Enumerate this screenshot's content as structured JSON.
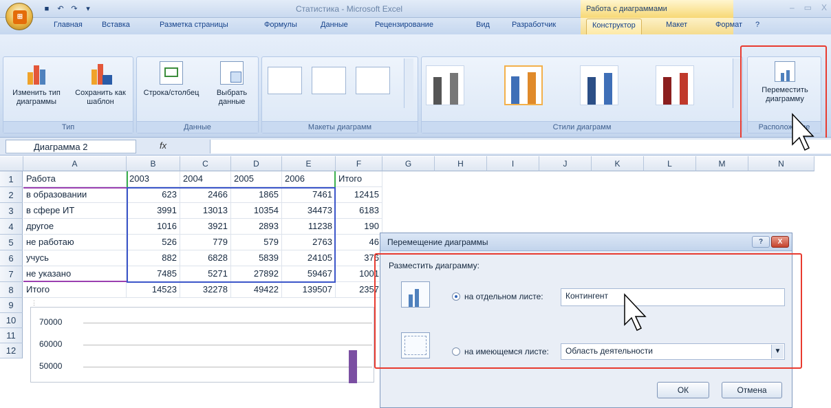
{
  "window": {
    "title": "Статистика - Microsoft Excel",
    "context_group": "Работа с диаграммами",
    "controls": [
      "–",
      "▭",
      "X"
    ]
  },
  "tabs": [
    "Главная",
    "Вставка",
    "Разметка страницы",
    "Формулы",
    "Данные",
    "Рецензирование",
    "Вид",
    "Разработчик",
    "Конструктор",
    "Макет",
    "Формат"
  ],
  "active_tab": "Конструктор",
  "ribbon": {
    "groups": {
      "type": {
        "label": "Тип",
        "change_type": "Изменить тип диаграммы",
        "save_template": "Сохранить как шаблон"
      },
      "data": {
        "label": "Данные",
        "switch_row_col": "Строка/столбец",
        "select_data": "Выбрать данные"
      },
      "layouts": {
        "label": "Макеты диаграмм"
      },
      "styles": {
        "label": "Стили диаграмм"
      },
      "location": {
        "label": "Расположение",
        "move_chart": "Переместить диаграмму"
      }
    }
  },
  "formula_bar": {
    "name_box": "Диаграмма 2",
    "fx": "fx",
    "content": ""
  },
  "columns": [
    "A",
    "B",
    "C",
    "D",
    "E",
    "F",
    "G",
    "H",
    "I",
    "J",
    "K",
    "L",
    "M",
    "N"
  ],
  "rows": [
    "1",
    "2",
    "3",
    "4",
    "5",
    "6",
    "7",
    "8",
    "9",
    "10",
    "11",
    "12"
  ],
  "table": {
    "header": [
      "Работа",
      "2003",
      "2004",
      "2005",
      "2006",
      "Итого"
    ],
    "rows": [
      [
        "в образовании",
        "623",
        "2466",
        "1865",
        "7461",
        "12415"
      ],
      [
        "в сфере ИТ",
        "3991",
        "13013",
        "10354",
        "34473",
        "6183"
      ],
      [
        "другое",
        "1016",
        "3921",
        "2893",
        "11238",
        "190"
      ],
      [
        "не работаю",
        "526",
        "779",
        "579",
        "2763",
        "46"
      ],
      [
        "учусь",
        "882",
        "6828",
        "5839",
        "24105",
        "376"
      ],
      [
        "не указано",
        "7485",
        "5271",
        "27892",
        "59467",
        "1001"
      ],
      [
        "Итого",
        "14523",
        "32278",
        "49422",
        "139507",
        "2357"
      ]
    ]
  },
  "chart": {
    "y_ticks": [
      "70000",
      "60000",
      "50000"
    ]
  },
  "dialog": {
    "title": "Перемещение диаграммы",
    "help": "?",
    "close": "X",
    "prompt": "Разместить диаграмму:",
    "option_new_sheet": "на отдельном листе:",
    "new_sheet_value": "Контингент",
    "option_existing_sheet": "на имеющемся листе:",
    "existing_sheet_value": "Область деятельности",
    "ok": "ОК",
    "cancel": "Отмена"
  },
  "colors": {
    "red_highlight": "#e83a2f",
    "style_gray": "#6d6d6d",
    "style_blue": "#3f6fb7",
    "style_orange": "#e08a2a",
    "style_red": "#c0392b"
  }
}
